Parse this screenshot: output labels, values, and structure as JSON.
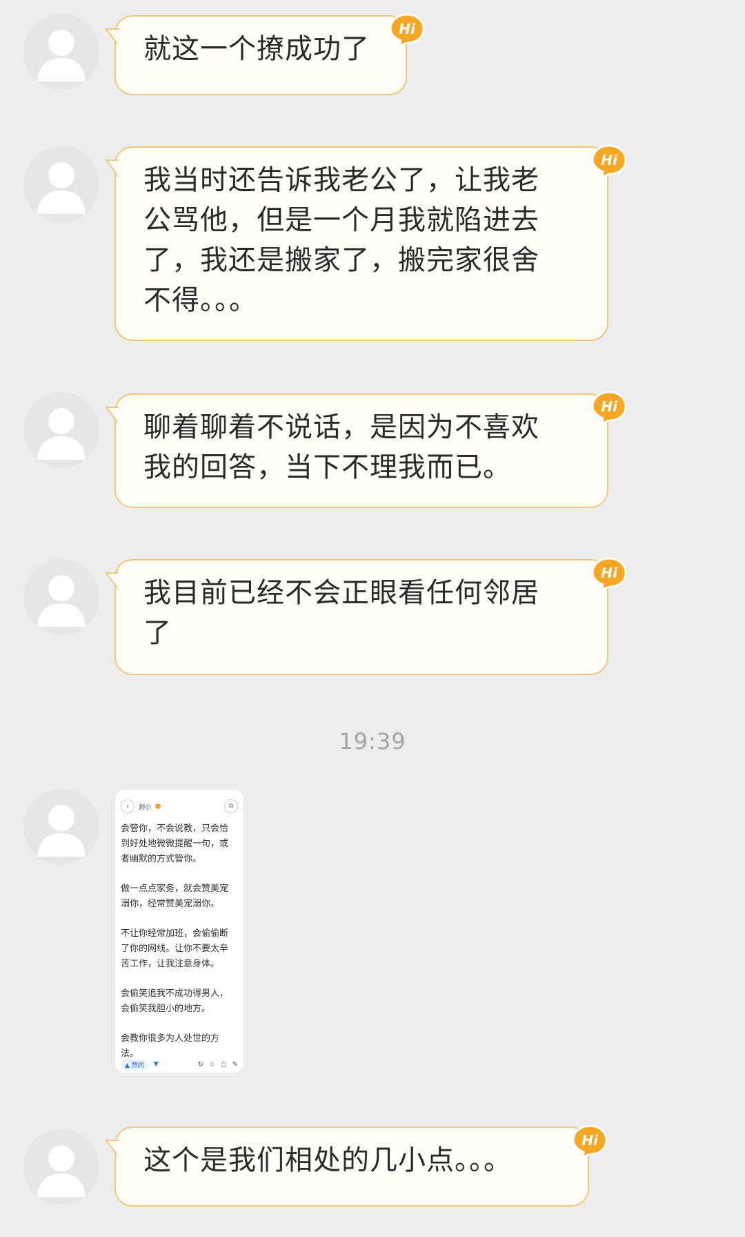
{
  "messages": [
    {
      "text": "就这一个撩成功了"
    },
    {
      "text": "我当时还告诉我老公了，让我老\n公骂他，但是一个月我就陷进去\n了，我还是搬家了，搬完家很舍\n不得。。。"
    },
    {
      "text": "聊着聊着不说话，是因为不喜欢\n我的回答，当下不理我而已。"
    },
    {
      "text": "我目前已经不会正眼看任何邻居\n了"
    },
    {
      "text": "这个是我们相处的几小点。。。"
    }
  ],
  "timestamp": "19:39",
  "badge_text": "Hi",
  "screenshot_message": {
    "back_icon": "‹",
    "title": "刘小",
    "paragraphs": [
      "会管你，不会说教，只会恰\n到好处地微微提醒一句，或\n者幽默的方式管你。",
      "做一点点家务，就会赞美宠\n溺你，经常赞美宠溺你。",
      "不让你经常加班，会偷偷断\n了你的网线。让你不要太辛\n苦工作，让我注意身体。",
      "会偷笑追我不成功得男人，\n会偷笑我胆小的地方。",
      "会教你很多为人处世的方\n法。"
    ],
    "vote_label": "▲ 赞同",
    "down_label": "▼"
  },
  "colors": {
    "background": "#ededed",
    "bubble_fill": "#fffdf5",
    "bubble_border": "#f0c77a",
    "badge": "#f5a623",
    "timestamp": "#a2a2a2"
  }
}
